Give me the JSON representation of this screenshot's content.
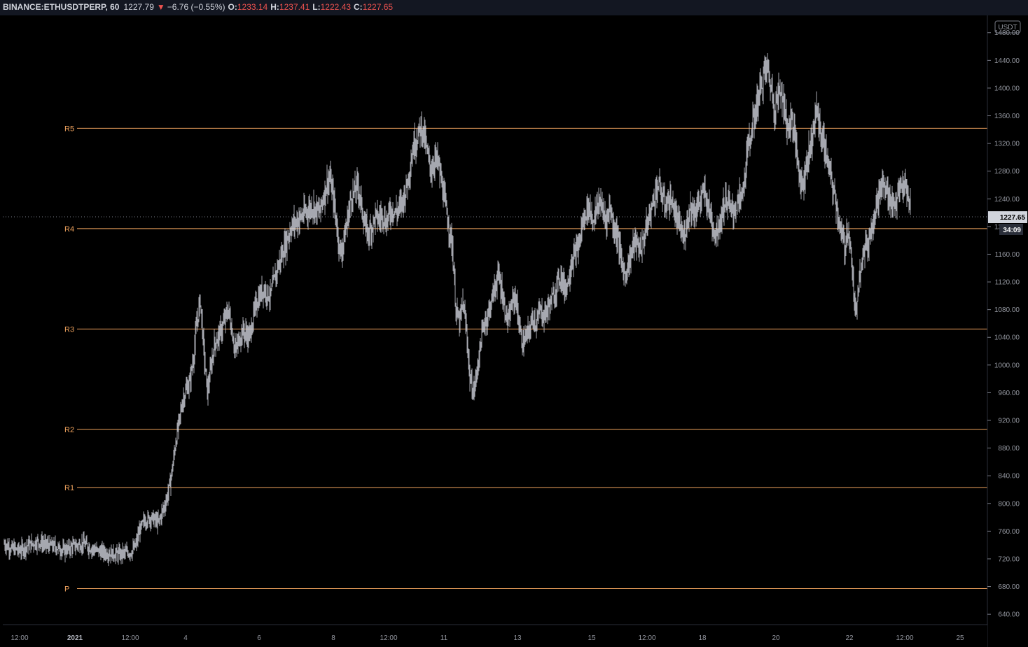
{
  "header": {
    "symbol": "BINANCE:ETHUSDTPERP, 60",
    "last": "1227.79",
    "change_arrow": "▼",
    "change": "−6.76 (−0.55%)",
    "o_label": "O:",
    "o_value": "1233.14",
    "h_label": "H:",
    "h_value": "1237.41",
    "l_label": "L:",
    "l_value": "1222.43",
    "c_label": "C:",
    "c_value": "1227.65"
  },
  "colors": {
    "background": "#000000",
    "bars": "#d1d4dc",
    "pivot": "#f0a35e",
    "down": "#ef5350",
    "header_bg": "#131722"
  },
  "chart_data": {
    "type": "ohlc",
    "currency_badge": "USDT",
    "last_price_label": "1227.65",
    "countdown_label": "34:09",
    "ylim": [
      625,
      1505
    ],
    "y_ticks": [
      "640.00",
      "680.00",
      "720.00",
      "760.00",
      "800.00",
      "840.00",
      "880.00",
      "920.00",
      "960.00",
      "1000.00",
      "1040.00",
      "1080.00",
      "1120.00",
      "1160.00",
      "1200.00",
      "1240.00",
      "1280.00",
      "1320.00",
      "1360.00",
      "1400.00",
      "1440.00",
      "1480.00"
    ],
    "x_ticks": [
      "12:00",
      "2021",
      "12:00",
      "4",
      "6",
      "8",
      "12:00",
      "11",
      "13",
      "15",
      "12:00",
      "18",
      "20",
      "22",
      "12:00",
      "25"
    ],
    "pivots": [
      {
        "label": "R5",
        "value": 1342
      },
      {
        "label": "R4",
        "value": 1197
      },
      {
        "label": "R3",
        "value": 1052
      },
      {
        "label": "R2",
        "value": 907
      },
      {
        "label": "R1",
        "value": 823
      },
      {
        "label": "P",
        "value": 677
      }
    ],
    "path": [
      [
        0,
        742
      ],
      [
        10,
        735
      ],
      [
        22,
        732
      ],
      [
        35,
        740
      ],
      [
        48,
        745
      ],
      [
        60,
        740
      ],
      [
        72,
        738
      ],
      [
        85,
        732
      ],
      [
        98,
        738
      ],
      [
        112,
        742
      ],
      [
        125,
        735
      ],
      [
        138,
        730
      ],
      [
        150,
        728
      ],
      [
        162,
        726
      ],
      [
        172,
        728
      ],
      [
        182,
        730
      ],
      [
        188,
        740
      ],
      [
        193,
        760
      ],
      [
        200,
        775
      ],
      [
        210,
        780
      ],
      [
        220,
        772
      ],
      [
        230,
        800
      ],
      [
        235,
        820
      ],
      [
        240,
        850
      ],
      [
        245,
        890
      ],
      [
        250,
        920
      ],
      [
        255,
        950
      ],
      [
        260,
        965
      ],
      [
        265,
        975
      ],
      [
        270,
        1010
      ],
      [
        275,
        1060
      ],
      [
        280,
        1095
      ],
      [
        285,
        1020
      ],
      [
        290,
        960
      ],
      [
        300,
        1030
      ],
      [
        310,
        1050
      ],
      [
        320,
        1080
      ],
      [
        330,
        1020
      ],
      [
        340,
        1050
      ],
      [
        350,
        1040
      ],
      [
        360,
        1090
      ],
      [
        370,
        1110
      ],
      [
        380,
        1100
      ],
      [
        390,
        1140
      ],
      [
        400,
        1170
      ],
      [
        410,
        1200
      ],
      [
        420,
        1210
      ],
      [
        430,
        1220
      ],
      [
        440,
        1230
      ],
      [
        450,
        1220
      ],
      [
        460,
        1260
      ],
      [
        465,
        1270
      ],
      [
        470,
        1240
      ],
      [
        475,
        1200
      ],
      [
        480,
        1160
      ],
      [
        485,
        1180
      ],
      [
        490,
        1210
      ],
      [
        495,
        1240
      ],
      [
        500,
        1250
      ],
      [
        505,
        1260
      ],
      [
        510,
        1230
      ],
      [
        515,
        1200
      ],
      [
        520,
        1190
      ],
      [
        525,
        1200
      ],
      [
        530,
        1215
      ],
      [
        535,
        1210
      ],
      [
        540,
        1220
      ],
      [
        545,
        1205
      ],
      [
        550,
        1220
      ],
      [
        555,
        1225
      ],
      [
        560,
        1220
      ],
      [
        565,
        1230
      ],
      [
        570,
        1240
      ],
      [
        575,
        1260
      ],
      [
        580,
        1290
      ],
      [
        585,
        1320
      ],
      [
        590,
        1330
      ],
      [
        595,
        1345
      ],
      [
        600,
        1330
      ],
      [
        605,
        1300
      ],
      [
        610,
        1280
      ],
      [
        615,
        1300
      ],
      [
        620,
        1290
      ],
      [
        625,
        1260
      ],
      [
        630,
        1230
      ],
      [
        635,
        1200
      ],
      [
        640,
        1170
      ],
      [
        645,
        1080
      ],
      [
        650,
        1060
      ],
      [
        655,
        1090
      ],
      [
        660,
        1050
      ],
      [
        665,
        980
      ],
      [
        670,
        960
      ],
      [
        675,
        990
      ],
      [
        680,
        1030
      ],
      [
        685,
        1060
      ],
      [
        690,
        1070
      ],
      [
        695,
        1090
      ],
      [
        700,
        1110
      ],
      [
        705,
        1130
      ],
      [
        710,
        1110
      ],
      [
        715,
        1080
      ],
      [
        720,
        1060
      ],
      [
        725,
        1090
      ],
      [
        730,
        1100
      ],
      [
        735,
        1060
      ],
      [
        740,
        1030
      ],
      [
        745,
        1040
      ],
      [
        750,
        1050
      ],
      [
        755,
        1070
      ],
      [
        760,
        1060
      ],
      [
        765,
        1080
      ],
      [
        770,
        1070
      ],
      [
        775,
        1080
      ],
      [
        780,
        1090
      ],
      [
        785,
        1100
      ],
      [
        790,
        1120
      ],
      [
        795,
        1130
      ],
      [
        800,
        1110
      ],
      [
        805,
        1120
      ],
      [
        810,
        1150
      ],
      [
        815,
        1160
      ],
      [
        820,
        1170
      ],
      [
        825,
        1200
      ],
      [
        830,
        1220
      ],
      [
        835,
        1230
      ],
      [
        840,
        1210
      ],
      [
        845,
        1220
      ],
      [
        850,
        1240
      ],
      [
        855,
        1220
      ],
      [
        860,
        1210
      ],
      [
        865,
        1230
      ],
      [
        870,
        1200
      ],
      [
        875,
        1190
      ],
      [
        880,
        1160
      ],
      [
        885,
        1130
      ],
      [
        890,
        1140
      ],
      [
        895,
        1160
      ],
      [
        900,
        1180
      ],
      [
        905,
        1170
      ],
      [
        910,
        1170
      ],
      [
        915,
        1190
      ],
      [
        920,
        1210
      ],
      [
        925,
        1230
      ],
      [
        930,
        1250
      ],
      [
        935,
        1260
      ],
      [
        940,
        1240
      ],
      [
        945,
        1230
      ],
      [
        950,
        1240
      ],
      [
        955,
        1230
      ],
      [
        960,
        1210
      ],
      [
        965,
        1200
      ],
      [
        970,
        1180
      ],
      [
        975,
        1210
      ],
      [
        980,
        1230
      ],
      [
        985,
        1220
      ],
      [
        990,
        1230
      ],
      [
        995,
        1240
      ],
      [
        1000,
        1250
      ],
      [
        1005,
        1230
      ],
      [
        1010,
        1210
      ],
      [
        1015,
        1190
      ],
      [
        1020,
        1200
      ],
      [
        1025,
        1220
      ],
      [
        1030,
        1240
      ],
      [
        1035,
        1230
      ],
      [
        1040,
        1220
      ],
      [
        1045,
        1230
      ],
      [
        1050,
        1240
      ],
      [
        1055,
        1250
      ],
      [
        1060,
        1300
      ],
      [
        1065,
        1330
      ],
      [
        1070,
        1350
      ],
      [
        1075,
        1380
      ],
      [
        1080,
        1400
      ],
      [
        1085,
        1420
      ],
      [
        1090,
        1430
      ],
      [
        1095,
        1400
      ],
      [
        1100,
        1370
      ],
      [
        1105,
        1390
      ],
      [
        1110,
        1400
      ],
      [
        1115,
        1360
      ],
      [
        1120,
        1340
      ],
      [
        1125,
        1360
      ],
      [
        1130,
        1320
      ],
      [
        1135,
        1280
      ],
      [
        1140,
        1260
      ],
      [
        1145,
        1290
      ],
      [
        1150,
        1310
      ],
      [
        1155,
        1340
      ],
      [
        1160,
        1370
      ],
      [
        1165,
        1340
      ],
      [
        1170,
        1320
      ],
      [
        1175,
        1300
      ],
      [
        1180,
        1270
      ],
      [
        1185,
        1250
      ],
      [
        1190,
        1220
      ],
      [
        1195,
        1190
      ],
      [
        1200,
        1170
      ],
      [
        1205,
        1200
      ],
      [
        1210,
        1150
      ],
      [
        1215,
        1070
      ],
      [
        1220,
        1120
      ],
      [
        1225,
        1160
      ],
      [
        1230,
        1170
      ],
      [
        1235,
        1180
      ],
      [
        1240,
        1210
      ],
      [
        1245,
        1230
      ],
      [
        1250,
        1250
      ],
      [
        1255,
        1260
      ],
      [
        1260,
        1250
      ],
      [
        1265,
        1240
      ],
      [
        1270,
        1230
      ],
      [
        1275,
        1240
      ],
      [
        1280,
        1255
      ],
      [
        1285,
        1260
      ],
      [
        1290,
        1240
      ],
      [
        1295,
        1228
      ]
    ]
  }
}
